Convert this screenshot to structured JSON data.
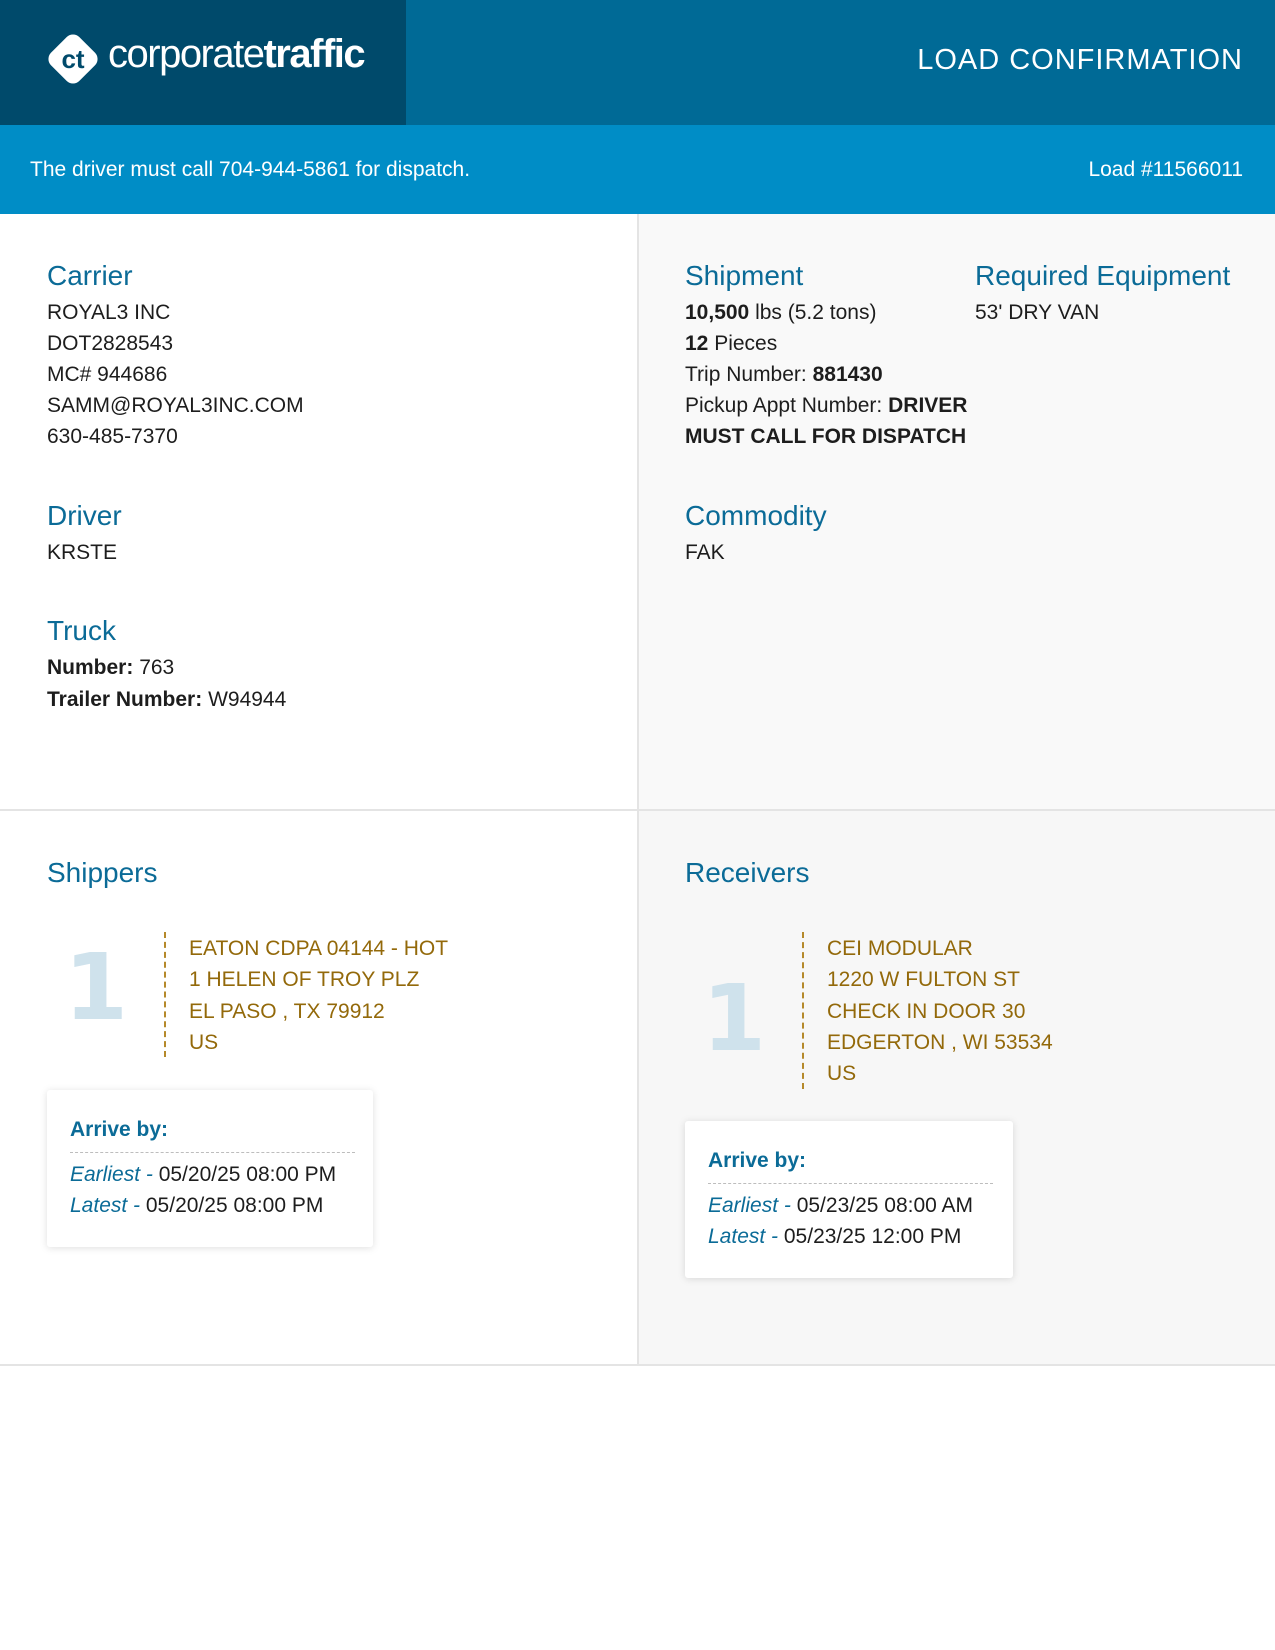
{
  "header": {
    "logo_part1": "corporate",
    "logo_part2": "traffic",
    "title": "LOAD CONFIRMATION"
  },
  "banner": {
    "message": "The driver must call 704-944-5861 for dispatch.",
    "load_number": "Load #11566011"
  },
  "carrier": {
    "heading": "Carrier",
    "lines": [
      "ROYAL3 INC",
      "DOT2828543",
      "MC# 944686",
      "SAMM@ROYAL3INC.COM",
      "630-485-7370"
    ]
  },
  "driver": {
    "heading": "Driver",
    "name": "KRSTE"
  },
  "truck": {
    "heading": "Truck",
    "number_label": "Number:",
    "number_value": "763",
    "trailer_label": "Trailer Number:",
    "trailer_value": "W94944"
  },
  "shipment": {
    "heading": "Shipment",
    "weight_value": "10,500",
    "weight_unit": "lbs (5.2 tons)",
    "pieces_value": "12",
    "pieces_label": "Pieces",
    "trip_label": "Trip Number:",
    "trip_value": "881430",
    "pickup_label": "Pickup Appt Number:",
    "pickup_value_1": "DRIVER",
    "pickup_value_2": "MUST CALL FOR DISPATCH"
  },
  "equipment": {
    "heading": "Required Equipment",
    "value": "53' DRY VAN"
  },
  "commodity": {
    "heading": "Commodity",
    "value": "FAK"
  },
  "shippers": {
    "heading": "Shippers",
    "stop_number": "1",
    "address": [
      "EATON CDPA 04144 - HOT",
      "1 HELEN OF TROY PLZ",
      "EL PASO , TX 79912",
      "US"
    ],
    "arrive_title": "Arrive by:",
    "earliest_label": "Earliest -",
    "earliest_value": " 05/20/25 08:00 PM",
    "latest_label": "Latest -",
    "latest_value": " 05/20/25 08:00 PM"
  },
  "receivers": {
    "heading": "Receivers",
    "stop_number": "1",
    "address": [
      "CEI MODULAR",
      "1220 W FULTON ST",
      "CHECK IN DOOR 30",
      "EDGERTON , WI 53534",
      "US"
    ],
    "arrive_title": "Arrive by:",
    "earliest_label": "Earliest -",
    "earliest_value": " 05/23/25 08:00 AM",
    "latest_label": "Latest -",
    "latest_value": " 05/23/25 12:00 PM"
  }
}
